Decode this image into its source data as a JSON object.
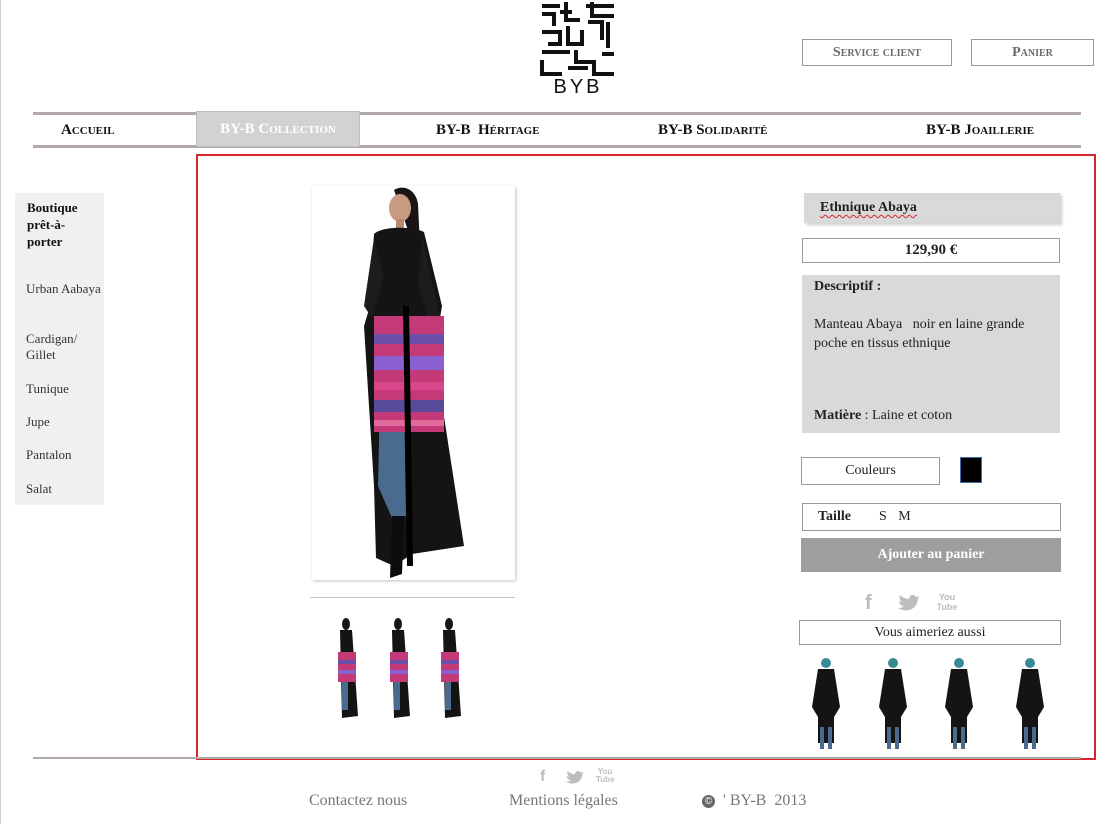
{
  "brand": {
    "logo_text": "BYB"
  },
  "header": {
    "service_client": "Service client",
    "panier": "Panier"
  },
  "nav": {
    "items": [
      {
        "label": "Accueil"
      },
      {
        "label": "BY-B Collection",
        "active": true
      },
      {
        "label": "BY-B  Héritage"
      },
      {
        "label": "BY-B Solidarité"
      },
      {
        "label": "BY-B Joaillerie"
      }
    ]
  },
  "sidebar": {
    "title": "Boutique prêt-à-porter",
    "items": [
      {
        "label": "Urban Aabaya"
      },
      {
        "label": "Cardigan/ Gillet"
      },
      {
        "label": "Tunique"
      },
      {
        "label": "Jupe"
      },
      {
        "label": "Pantalon"
      },
      {
        "label": "Salat"
      }
    ]
  },
  "product": {
    "name": "Ethnique Abaya",
    "price": "129,90 €",
    "desc_label": "Descriptif :",
    "description": "Manteau Abaya   noir en laine grande poche en tissus ethnique",
    "matiere_label": "Matière",
    "matiere_value": " : Laine et coton",
    "couleurs_label": "Couleurs",
    "swatch_color": "#000000",
    "taille_label": "Taille",
    "sizes": [
      "S",
      "M"
    ],
    "add_to_cart": "Ajouter au panier"
  },
  "social": {
    "icons": [
      "facebook-icon",
      "twitter-icon",
      "youtube-icon"
    ],
    "youtube_text": "You Tube"
  },
  "recommendations": {
    "label": "Vous aimeriez aussi"
  },
  "footer": {
    "contact": "Contactez nous",
    "mentions": "Mentions légales",
    "copyright": "' BY-B  2013",
    "copyright_symbol": "©"
  },
  "colors": {
    "frame": "#d8262b",
    "nav_active_bg": "#d2d2d2",
    "button_grey": "#9e9e9e",
    "panel_grey": "#d9d9d9"
  }
}
